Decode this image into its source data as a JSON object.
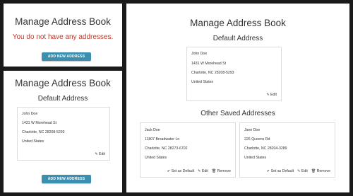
{
  "title": "Manage Address Book",
  "empty_message": "You do not have any addresses.",
  "add_button": "ADD NEW ADDRESS",
  "default_heading": "Default Address",
  "other_heading": "Other Saved Addresses",
  "default_address": {
    "name": "John Doe",
    "street": "1431 W Morehead St",
    "city": "Charlotte, NC 28208-5293",
    "country": "United States",
    "edit": "Edit"
  },
  "other_addresses": [
    {
      "name": "Jack Doe",
      "street": "11807 Broadwater Ln",
      "city": "Charlotte, NC 28273-6702",
      "country": "United States",
      "set_default": "Set as Default",
      "edit": "Edit",
      "remove": "Remove"
    },
    {
      "name": "Jane Doe",
      "street": "226 Queens Rd",
      "city": "Charlotte, NC 28204-3289",
      "country": "United States",
      "set_default": "Set as Default",
      "edit": "Edit",
      "remove": "Remove"
    }
  ],
  "icons": {
    "check": "check-icon",
    "pencil": "pencil-icon",
    "trash": "trash-icon"
  }
}
